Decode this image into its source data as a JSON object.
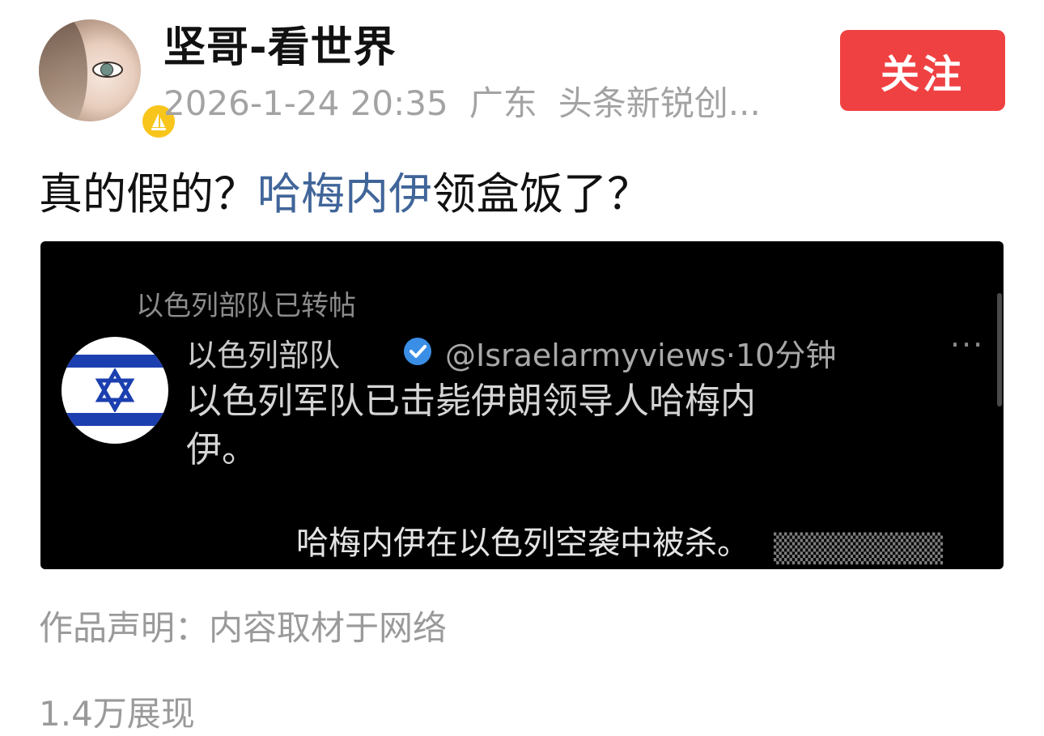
{
  "author": {
    "name": "坚哥-看世界",
    "time": "2026-1-24 20:35",
    "location": "广东",
    "honor": "头条新锐创..."
  },
  "follow_button": {
    "label": "关注"
  },
  "post": {
    "text_before": "真的假的？",
    "link_text": "哈梅内伊",
    "text_after": "领盒饭了？"
  },
  "media": {
    "retweet_line": "以色列部队已转帖",
    "tweet_author": "以色列部队",
    "tweet_handle": "@Israelarmyviews·10分钟",
    "more": "···",
    "tweet_body": "以色列军队已击毙伊朗领导人哈梅内伊。",
    "subtitle": "哈梅内伊在以色列空袭中被杀。"
  },
  "footer": {
    "declaration": "作品声明：内容取材于网络",
    "views": "1.4万展现"
  },
  "colors": {
    "follow_bg": "#f04142",
    "link": "#406599",
    "badge": "#f8c51c"
  }
}
